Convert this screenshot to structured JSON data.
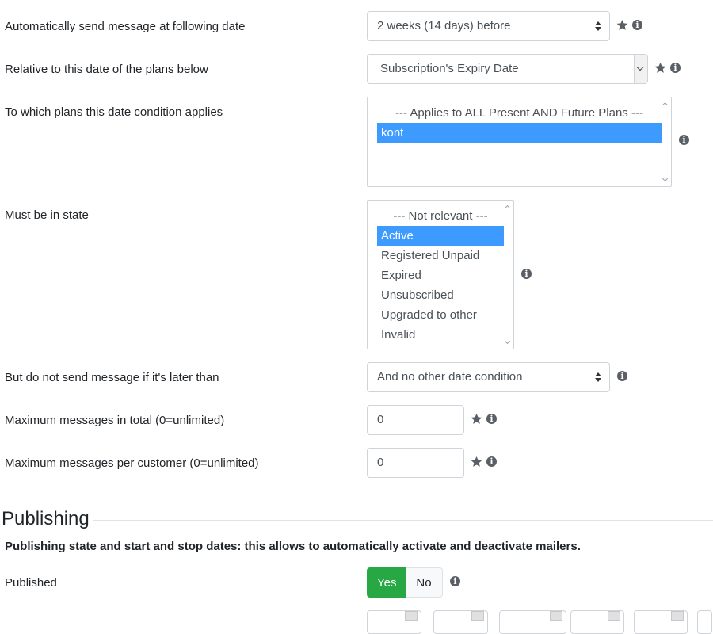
{
  "fields": {
    "send_date": {
      "label": "Automatically send message at following date",
      "value": "2 weeks (14 days) before"
    },
    "relative_date": {
      "label": "Relative to this date of the plans below",
      "value": "Subscription's Expiry Date"
    },
    "plans": {
      "label": "To which plans this date condition applies",
      "options": [
        "--- Applies to ALL Present AND Future Plans ---",
        "kont"
      ],
      "selected": "kont"
    },
    "state": {
      "label": "Must be in state",
      "options": [
        "--- Not relevant ---",
        "Active",
        "Registered Unpaid",
        "Expired",
        "Unsubscribed",
        "Upgraded to other",
        "Invalid"
      ],
      "selected": "Active"
    },
    "later_than": {
      "label": "But do not send message if it's later than",
      "value": "And no other date condition"
    },
    "max_total": {
      "label": "Maximum messages in total (0=unlimited)",
      "value": "0"
    },
    "max_per_customer": {
      "label": "Maximum messages per customer (0=unlimited)",
      "value": "0"
    }
  },
  "publishing": {
    "legend": "Publishing",
    "description": "Publishing state and start and stop dates: this allows to automatically activate and deactivate mailers.",
    "published": {
      "label": "Published",
      "yes_label": "Yes",
      "no_label": "No",
      "selected": "Yes"
    }
  },
  "icons": {
    "star": "star-icon",
    "info": "info-icon",
    "info_glyph": "i"
  },
  "colors": {
    "selected_option": "#3d9bff",
    "toggle_yes": "#28a745",
    "icon": "#5a5f66"
  }
}
